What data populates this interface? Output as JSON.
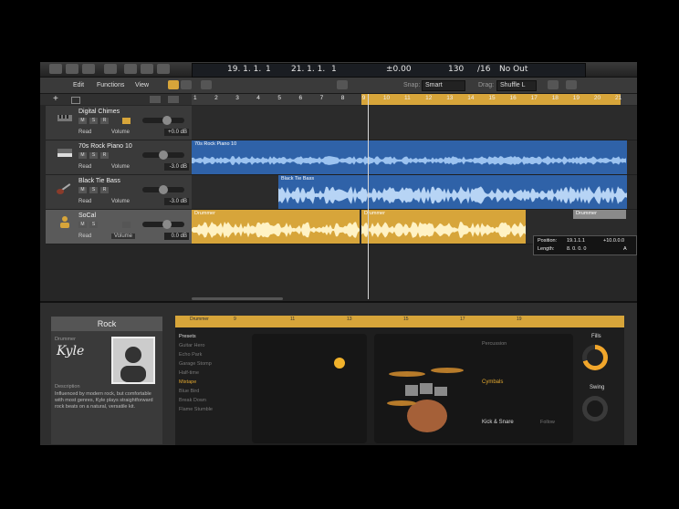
{
  "lcd": {
    "pos1": "19. 1. 1.",
    "pos1b": "1",
    "pos2": "21. 1. 1.",
    "pos2b": "1",
    "semitone": "±0.00",
    "tempo": "130",
    "sig": "/16",
    "key": "No Out"
  },
  "toolbar": {
    "edit": "Edit",
    "functions": "Functions",
    "view": "View",
    "snap_label": "Snap:",
    "snap_value": "Smart",
    "drag_label": "Drag:",
    "drag_value": "Shuffle L"
  },
  "ruler": {
    "ticks": [
      "1",
      "2",
      "3",
      "4",
      "5",
      "6",
      "7",
      "8",
      "9",
      "10",
      "11",
      "12",
      "13",
      "14",
      "15",
      "16",
      "17",
      "18",
      "19",
      "20",
      "21"
    ]
  },
  "tracks": [
    {
      "num": "",
      "name": "Digital Chimes",
      "mode": "Read",
      "param": "Volume",
      "db": "+0.0 dB"
    },
    {
      "num": "",
      "name": "70s Rock Piano 10",
      "mode": "Read",
      "param": "Volume",
      "db": "-3.0 dB"
    },
    {
      "num": "",
      "name": "Black Tie Bass",
      "mode": "Read",
      "param": "Volume",
      "db": "-3.0 dB"
    },
    {
      "num": "",
      "name": "SoCal",
      "mode": "Read",
      "param": "Volume",
      "db": "0.0 dB"
    }
  ],
  "regions": {
    "piano": "70s Rock Piano 10",
    "bass": "Black Tie Bass",
    "drummer1": "Drummer",
    "drummer2": "Drummer",
    "drummer3": "Drummer"
  },
  "inspector": {
    "position_label": "Position:",
    "position_value": "19.1.1.1",
    "position_value2": "+10.0.0.0",
    "length_label": "Length:",
    "length_value": "8. 0. 0. 0",
    "length_value2": "A"
  },
  "drummer_panel": {
    "genre": "Rock",
    "drummer_label": "Drummer",
    "drummer_name": "Kyle",
    "description_label": "Description",
    "description": "Influenced by modern rock, but comfortable with most genres, Kyle plays straightforward rock beats on a natural, versatile kit."
  },
  "editor": {
    "bar_label": "Drummer",
    "bar_ticks": [
      "9",
      "11",
      "13",
      "15",
      "17",
      "19"
    ],
    "presets_label": "Presets",
    "presets": [
      "Guitar Hero",
      "Echo Park",
      "Garage Stomp",
      "Half-time",
      "Mixtape",
      "Blue Bird",
      "Break Down",
      "Flame Stumble"
    ],
    "selected_preset": "Mixtape",
    "percussion": "Percussion",
    "cymbals": "Cymbals",
    "kick_snare": "Kick & Snare",
    "follow": "Follow",
    "fills": "Fills",
    "swing": "Swing"
  }
}
